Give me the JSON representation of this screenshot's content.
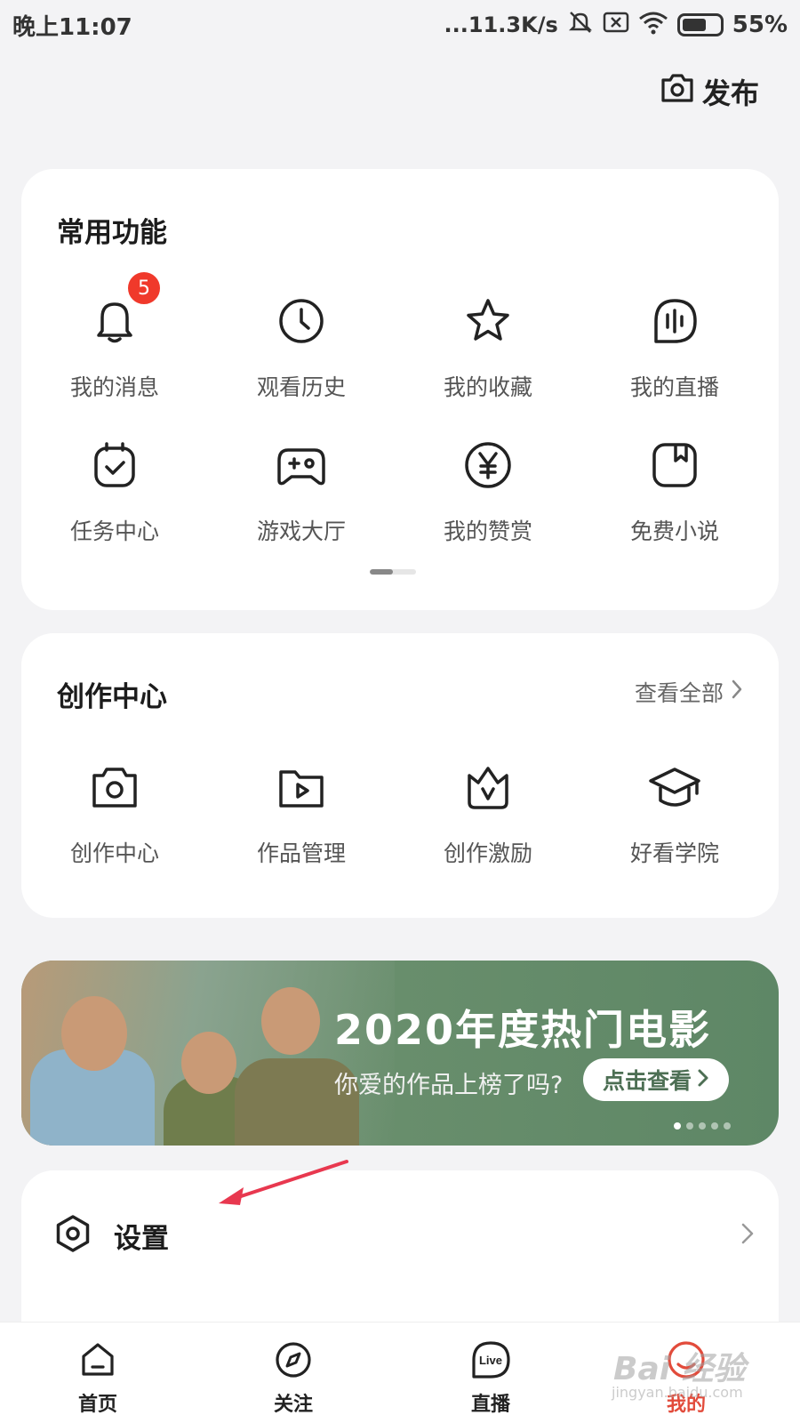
{
  "status_bar": {
    "time": "晚上11:07",
    "network_speed": "...11.3K/s",
    "battery": "55%"
  },
  "header": {
    "publish_label": "发布"
  },
  "common_functions": {
    "title": "常用功能",
    "items": [
      {
        "label": "我的消息",
        "icon": "bell-icon",
        "badge": "5"
      },
      {
        "label": "观看历史",
        "icon": "clock-icon"
      },
      {
        "label": "我的收藏",
        "icon": "star-icon"
      },
      {
        "label": "我的直播",
        "icon": "live-wave-icon"
      },
      {
        "label": "任务中心",
        "icon": "calendar-check-icon"
      },
      {
        "label": "游戏大厅",
        "icon": "gamepad-icon"
      },
      {
        "label": "我的赞赏",
        "icon": "yen-icon"
      },
      {
        "label": "免费小说",
        "icon": "book-icon"
      }
    ],
    "pager": {
      "pages": 2,
      "current": 1
    }
  },
  "creation_center": {
    "title": "创作中心",
    "view_all": "查看全部",
    "items": [
      {
        "label": "创作中心",
        "icon": "camera-icon"
      },
      {
        "label": "作品管理",
        "icon": "video-folder-icon"
      },
      {
        "label": "创作激励",
        "icon": "crown-icon"
      },
      {
        "label": "好看学院",
        "icon": "graduation-cap-icon"
      }
    ]
  },
  "banner": {
    "title": "2020年度热门电影",
    "subtitle": "你爱的作品上榜了吗?",
    "button": "点击查看",
    "dots": 5,
    "active_dot": 1
  },
  "settings": {
    "label": "设置"
  },
  "bottom_nav": {
    "items": [
      {
        "label": "首页",
        "icon": "home-icon"
      },
      {
        "label": "关注",
        "icon": "compass-icon"
      },
      {
        "label": "直播",
        "icon": "live-icon"
      },
      {
        "label": "我的",
        "icon": "profile-icon",
        "active": true
      }
    ]
  },
  "watermark": {
    "text": "Bai 经验",
    "sub": "jingyan.baidu.com"
  },
  "colors": {
    "accent": "#e24b3b",
    "badge": "#f0392b",
    "background": "#f3f3f5",
    "annotation_arrow": "#e8384f"
  }
}
